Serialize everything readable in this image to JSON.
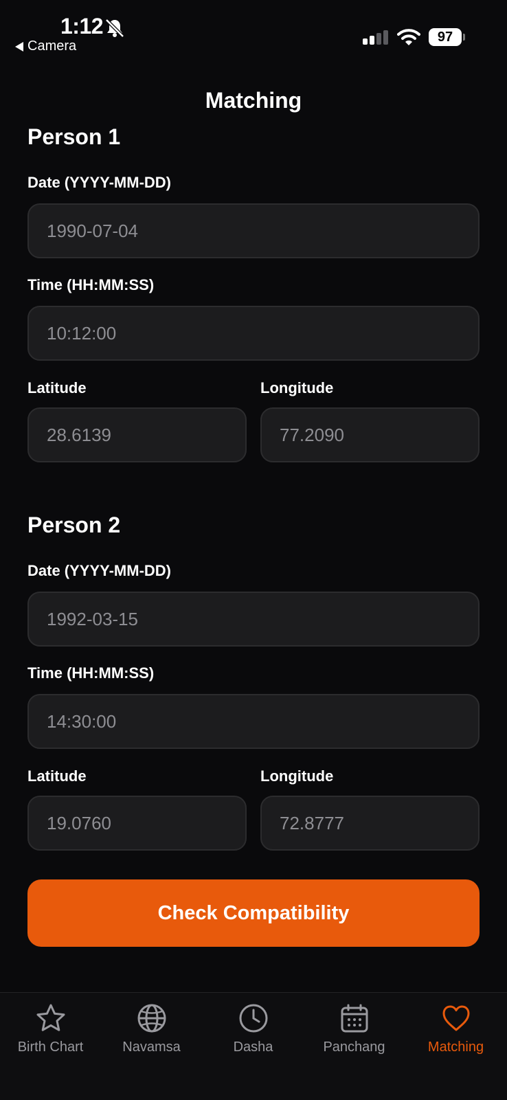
{
  "status_bar": {
    "time": "1:12",
    "back_label": "Camera",
    "battery": "97"
  },
  "header": {
    "title": "Matching"
  },
  "person1": {
    "heading": "Person 1",
    "date_label": "Date (YYYY-MM-DD)",
    "date_placeholder": "1990-07-04",
    "time_label": "Time (HH:MM:SS)",
    "time_placeholder": "10:12:00",
    "latitude_label": "Latitude",
    "latitude_placeholder": "28.6139",
    "longitude_label": "Longitude",
    "longitude_placeholder": "77.2090"
  },
  "person2": {
    "heading": "Person 2",
    "date_label": "Date (YYYY-MM-DD)",
    "date_placeholder": "1992-03-15",
    "time_label": "Time (HH:MM:SS)",
    "time_placeholder": "14:30:00",
    "latitude_label": "Latitude",
    "latitude_placeholder": "19.0760",
    "longitude_label": "Longitude",
    "longitude_placeholder": "72.8777"
  },
  "action": {
    "check_label": "Check Compatibility"
  },
  "tabs": [
    {
      "label": "Birth Chart",
      "icon": "star-icon"
    },
    {
      "label": "Navamsa",
      "icon": "globe-icon"
    },
    {
      "label": "Dasha",
      "icon": "clock-icon"
    },
    {
      "label": "Panchang",
      "icon": "calendar-icon"
    },
    {
      "label": "Matching",
      "icon": "heart-icon",
      "active": true
    }
  ],
  "colors": {
    "accent": "#e85a0c",
    "background": "#0a0a0c",
    "field_background": "#1c1c1e",
    "placeholder_text": "#8e8e93",
    "inactive_tab": "#9a9a9f"
  }
}
